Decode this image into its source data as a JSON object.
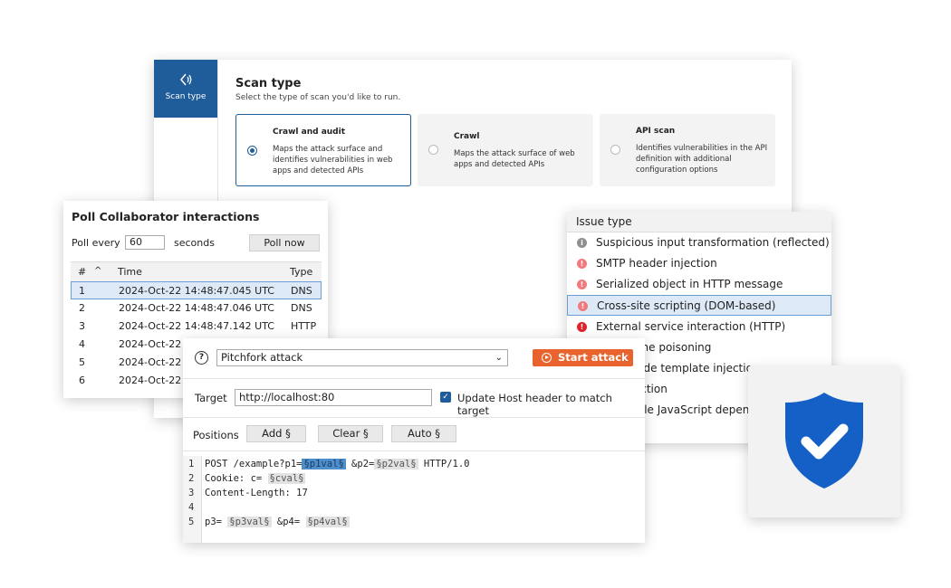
{
  "scan": {
    "side_tab_label": "Scan type",
    "title": "Scan type",
    "subtitle": "Select the type of scan you'd like to run.",
    "options": [
      {
        "title": "Crawl and audit",
        "desc": "Maps the attack surface and identifies vulnerabilities in web apps and detected APIs",
        "selected": true
      },
      {
        "title": "Crawl",
        "desc": "Maps the attack surface of web apps and detected APIs",
        "selected": false
      },
      {
        "title": "API scan",
        "desc": "Identifies vulnerabilities in the API definition with additional configuration options",
        "selected": false
      }
    ]
  },
  "poll": {
    "title": "Poll Collaborator interactions",
    "every_label": "Poll every",
    "interval_value": "60",
    "seconds_label": "seconds",
    "poll_now": "Poll now",
    "columns": {
      "num": "#",
      "sort": "^",
      "time": "Time",
      "type": "Type"
    },
    "rows": [
      {
        "num": "1",
        "time": "2024-Oct-22 14:48:47.045 UTC",
        "type": "DNS",
        "selected": true
      },
      {
        "num": "2",
        "time": "2024-Oct-22 14:48:47.046 UTC",
        "type": "DNS"
      },
      {
        "num": "3",
        "time": "2024-Oct-22 14:48:47.142 UTC",
        "type": "HTTP"
      },
      {
        "num": "4",
        "time": "2024-Oct-22",
        "type": ""
      },
      {
        "num": "5",
        "time": "2024-Oct-22",
        "type": ""
      },
      {
        "num": "6",
        "time": "2024-Oct-22",
        "type": ""
      }
    ]
  },
  "issues": {
    "header": "Issue type",
    "items": [
      {
        "label": "Suspicious input transformation (reflected)",
        "severity": "info"
      },
      {
        "label": "SMTP header injection",
        "severity": "high"
      },
      {
        "label": "Serialized object in HTTP message",
        "severity": "high"
      },
      {
        "label": "Cross-site scripting (DOM-based)",
        "severity": "high",
        "selected": true
      },
      {
        "label": "External service interaction (HTTP)",
        "severity": "high-solid"
      },
      {
        "label": "Web cache poisoning",
        "severity": "high"
      },
      {
        "label": "Server-side template injection",
        "severity": "high"
      },
      {
        "label": "SQL injection",
        "severity": "high"
      },
      {
        "label": "Vulnerable JavaScript dependency",
        "severity": "high"
      }
    ]
  },
  "intruder": {
    "help_icon": "?",
    "attack_type": "Pitchfork attack",
    "start_attack": "Start attack",
    "target_label": "Target",
    "target_value": "http://localhost:80",
    "update_host_label": "Update Host header to match target",
    "update_host_checked": true,
    "positions_label": "Positions",
    "add_label": "Add §",
    "clear_label": "Clear §",
    "auto_label": "Auto §",
    "code": {
      "l1_pre": "POST /example?p1=",
      "l1_m1": "§p1val§",
      "l1_mid": " &p2=",
      "l1_m2": "§p2val§",
      "l1_post": " HTTP/1.0",
      "l2_pre": "Cookie: c=",
      "l2_m1": "§cval§",
      "l3": "Content-Length: 17",
      "l5_pre": "p3=",
      "l5_m1": "§p3val§",
      "l5_mid": " &p4=",
      "l5_m2": "§p4val§"
    },
    "line_numbers": [
      "1",
      "2",
      "3",
      "4",
      "5"
    ]
  },
  "colors": {
    "accent": "#1f5c9a",
    "start_button": "#e8632d",
    "shield": "#1560c7",
    "severity_high": "#e0454a",
    "severity_info": "#8f8f8f"
  }
}
